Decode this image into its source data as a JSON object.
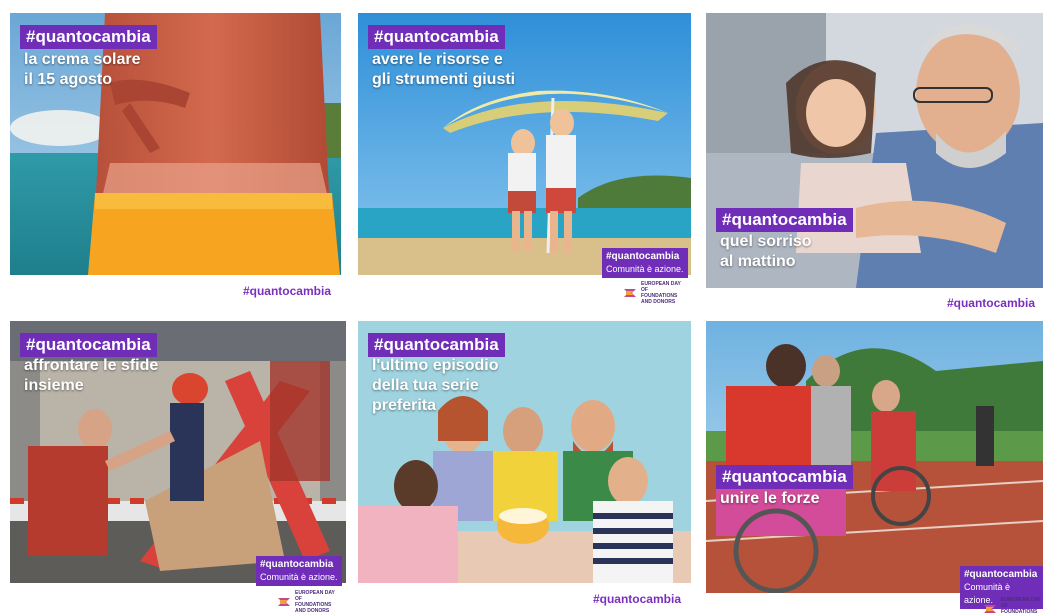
{
  "hashtag": "#quantocambia",
  "badge_line": "Comunità è azione.",
  "logo_text": "EUROPEAN DAY OF FOUNDATIONS AND DONORS",
  "cards": [
    {
      "id": "card1",
      "lines": [
        "la crema solare",
        "il 15 agosto"
      ]
    },
    {
      "id": "card2",
      "lines": [
        "avere le risorse e",
        "gli strumenti giusti"
      ]
    },
    {
      "id": "card3",
      "lines": [
        "quel sorriso",
        "al mattino"
      ]
    },
    {
      "id": "card4",
      "lines": [
        "affrontare le sfide",
        "insieme"
      ]
    },
    {
      "id": "card5",
      "lines": [
        "l'ultimo episodio",
        "della tua serie",
        "preferita"
      ]
    },
    {
      "id": "card6",
      "lines": [
        "unire le forze"
      ]
    }
  ]
}
